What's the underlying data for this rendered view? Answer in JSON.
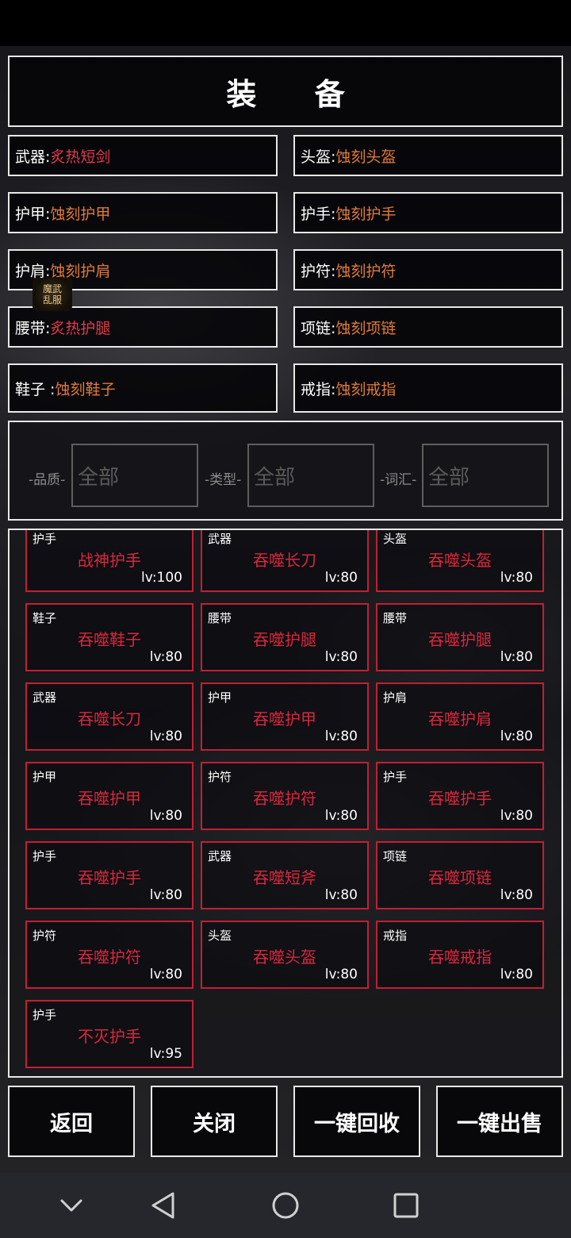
{
  "title": "装 备",
  "slots": [
    {
      "name": "武器:",
      "item": "炙热短剑",
      "highlight": true
    },
    {
      "name": "头盔:",
      "item": "蚀刻头盔",
      "highlight": false
    },
    {
      "name": "护甲:",
      "item": "蚀刻护甲",
      "highlight": false
    },
    {
      "name": "护手:",
      "item": "蚀刻护手",
      "highlight": false
    },
    {
      "name": "护肩:",
      "item": "蚀刻护肩",
      "highlight": false
    },
    {
      "name": "护符:",
      "item": "蚀刻护符",
      "highlight": false
    },
    {
      "name": "腰带:",
      "item": "炙热护腿",
      "highlight": true
    },
    {
      "name": "项链:",
      "item": "蚀刻项链",
      "highlight": false
    },
    {
      "name": "鞋子 :",
      "item": "蚀刻鞋子",
      "highlight": false
    },
    {
      "name": "戒指:",
      "item": "蚀刻戒指",
      "highlight": false
    }
  ],
  "logo_text": "魔武乱服",
  "filters": [
    {
      "label": "-品质-",
      "value": "全部"
    },
    {
      "label": "-类型-",
      "value": "全部"
    },
    {
      "label": "-词汇-",
      "value": "全部"
    }
  ],
  "items": [
    {
      "type": "护手",
      "name": "战神护手",
      "level": "lv:100"
    },
    {
      "type": "武器",
      "name": "吞噬长刀",
      "level": "lv:80"
    },
    {
      "type": "头盔",
      "name": "吞噬头盔",
      "level": "lv:80"
    },
    {
      "type": "鞋子",
      "name": "吞噬鞋子",
      "level": "lv:80"
    },
    {
      "type": "腰带",
      "name": "吞噬护腿",
      "level": "lv:80"
    },
    {
      "type": "腰带",
      "name": "吞噬护腿",
      "level": "lv:80"
    },
    {
      "type": "武器",
      "name": "吞噬长刀",
      "level": "lv:80"
    },
    {
      "type": "护甲",
      "name": "吞噬护甲",
      "level": "lv:80"
    },
    {
      "type": "护肩",
      "name": "吞噬护肩",
      "level": "lv:80"
    },
    {
      "type": "护甲",
      "name": "吞噬护甲",
      "level": "lv:80"
    },
    {
      "type": "护符",
      "name": "吞噬护符",
      "level": "lv:80"
    },
    {
      "type": "护手",
      "name": "吞噬护手",
      "level": "lv:80"
    },
    {
      "type": "护手",
      "name": "吞噬护手",
      "level": "lv:80"
    },
    {
      "type": "武器",
      "name": "吞噬短斧",
      "level": "lv:80"
    },
    {
      "type": "项链",
      "name": "吞噬项链",
      "level": "lv:80"
    },
    {
      "type": "护符",
      "name": "吞噬护符",
      "level": "lv:80"
    },
    {
      "type": "头盔",
      "name": "吞噬头盔",
      "level": "lv:80"
    },
    {
      "type": "戒指",
      "name": "吞噬戒指",
      "level": "lv:80"
    },
    {
      "type": "护手",
      "name": "不灭护手",
      "level": "lv:95"
    }
  ],
  "actions": [
    "返回",
    "关闭",
    "一键回收",
    "一键出售"
  ],
  "nav": [
    "chevron-down-icon",
    "back-triangle-icon",
    "home-circle-icon",
    "recents-square-icon"
  ],
  "colors": {
    "item_normal": "#e07a3a",
    "item_highlight": "#e23a48",
    "card_border": "#c21f33",
    "card_name": "#d8283c"
  }
}
